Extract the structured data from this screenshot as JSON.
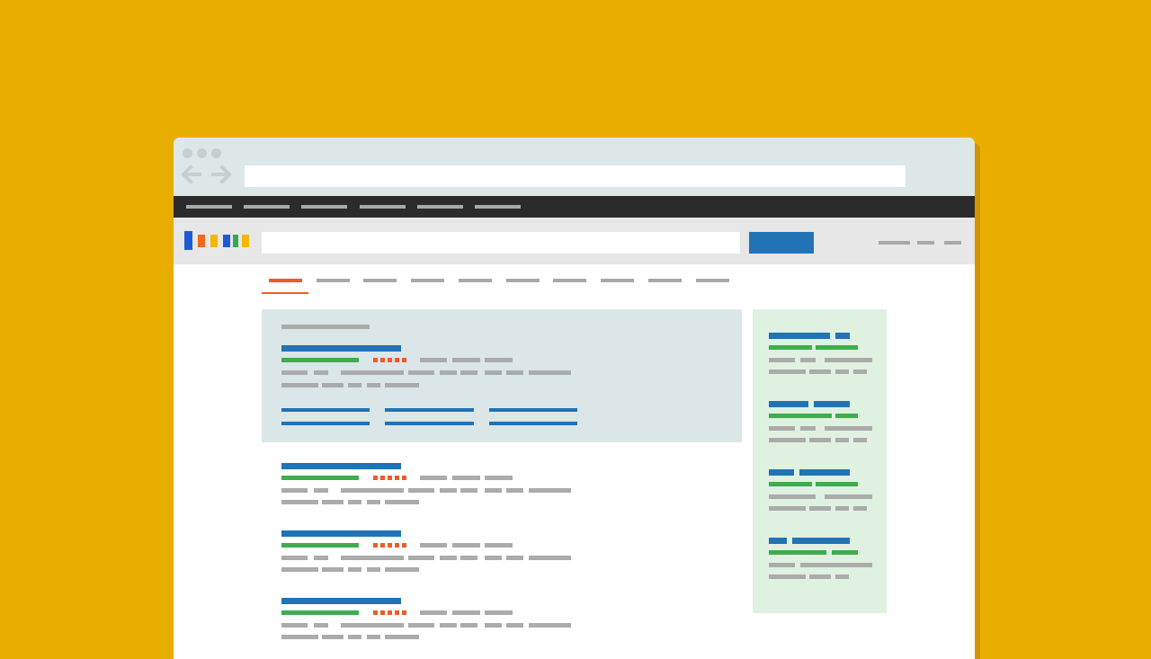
{
  "colors": {
    "background": "#E9AD00",
    "chrome": "#DCE7E8",
    "navbar": "#2B2B2B",
    "search_bar": "#E7E7E7",
    "search_button": "#2272B6",
    "result_title": "#2272B6",
    "result_url": "#3DAD4D",
    "rating": "#F05A28",
    "snippet": "#ABABAB",
    "active_tab": "#F05A28",
    "featured_panel": "#DAE6E7",
    "sidebar_panel": "#DFF1E1"
  },
  "logo_colors": [
    "#1F5AD6",
    "#EF6A1C",
    "#F2B800",
    "#1F5AD6",
    "#34A853",
    "#F2B800"
  ],
  "icons": [
    "window-dot",
    "back-arrow-icon",
    "forward-arrow-icon"
  ],
  "nav_link_count": 6,
  "tab_count": 10,
  "active_tab_index": 0,
  "result_count": 3,
  "sidebar_card_count": 4
}
